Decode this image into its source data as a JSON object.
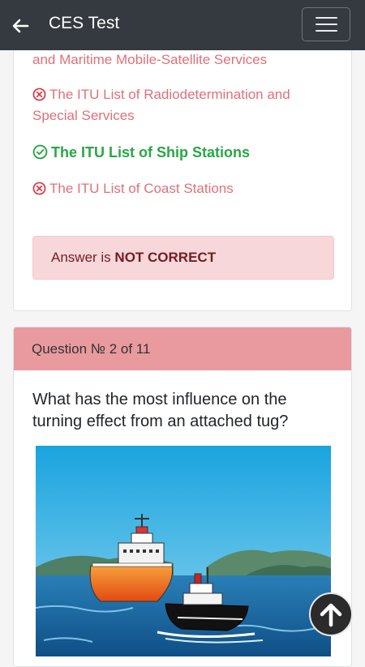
{
  "header": {
    "title": "CES Test",
    "back_icon": "arrow-left-icon",
    "menu_icon": "hamburger-menu-icon",
    "background": "#343a40"
  },
  "previous_question": {
    "options": [
      {
        "text": "and Maritime Mobile-Satellite Services",
        "status": "wrong"
      },
      {
        "text": "The ITU List of Radiodetermination and",
        "text2": "Special Services",
        "status": "wrong"
      },
      {
        "text": "The ITU List of Ship Stations",
        "status": "correct"
      },
      {
        "text": "The ITU List of Coast Stations",
        "status": "wrong"
      }
    ],
    "result_prefix": "Answer is ",
    "result_value": "NOT CORRECT"
  },
  "current_question": {
    "header": "Question № 2 of 11",
    "text": "What has the most influence on the turning effect from an attached tug?",
    "image": "ship-and-tug-illustration"
  },
  "fab": {
    "icon": "arrow-up-icon"
  },
  "colors": {
    "wrong": "#e0707a",
    "correct": "#28a745",
    "alert_bg": "#f8d7da",
    "alert_text": "#721c24",
    "question_header_bg": "#e99a9e"
  }
}
